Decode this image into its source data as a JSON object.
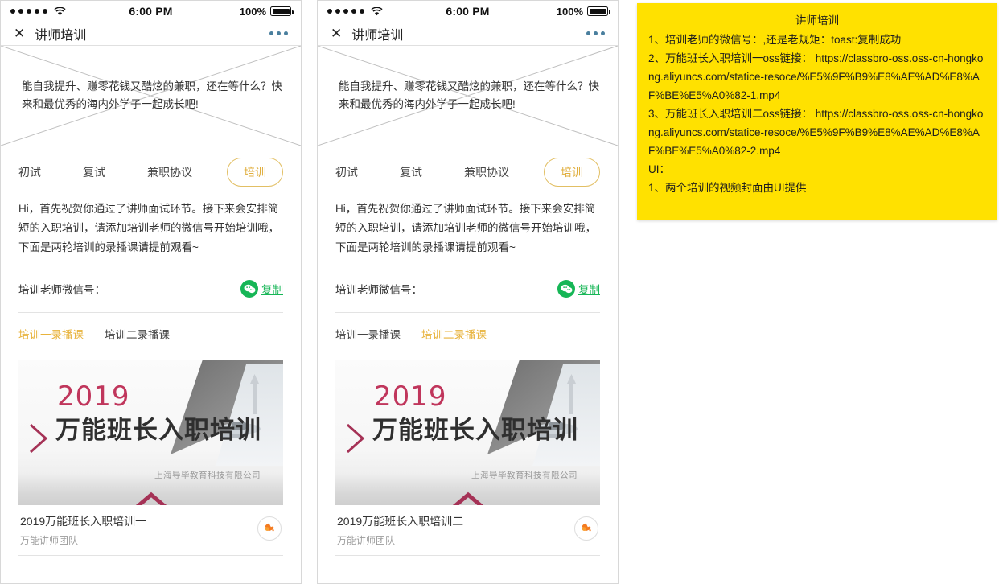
{
  "status_bar": {
    "signal_dots": 5,
    "wifi_icon": "wifi-icon",
    "time": "6:00 PM",
    "battery_pct": "100%",
    "battery_icon": "battery-full-icon"
  },
  "nav": {
    "close_label": "✕",
    "title": "讲师培训",
    "more_icon": "more-horizontal-icon"
  },
  "banner": {
    "placeholder_icon": "image-placeholder-cross",
    "text": "能自我提升、赚零花钱又酷炫的兼职，还在等什么？快来和最优秀的海内外学子一起成长吧!"
  },
  "steps": [
    {
      "label": "初试",
      "active": false
    },
    {
      "label": "复试",
      "active": false
    },
    {
      "label": "兼职协议",
      "active": false
    },
    {
      "label": "培训",
      "active": true
    }
  ],
  "intro": "Hi，首先祝贺你通过了讲师面试环节。接下来会安排简短的入职培训，请添加培训老师的微信号开始培训哦，下面是两轮培训的录播课请提前观看~",
  "wechat": {
    "label": "培训老师微信号：",
    "value": "",
    "icon": "wechat-icon",
    "copy_label": "复制"
  },
  "video_tabs": [
    {
      "label": "培训一录播课"
    },
    {
      "label": "培训二录播课"
    }
  ],
  "phones": [
    {
      "active_video_tab_index": 0,
      "video": {
        "thumb_year": "2019",
        "thumb_title": "万能班长入职培训",
        "thumb_watermark": "上海导毕教育科技有限公司",
        "title": "2019万能班长入职培训一",
        "subtitle": "万能讲师团队",
        "logo_icon": "brand-hand-logo-icon"
      }
    },
    {
      "active_video_tab_index": 1,
      "video": {
        "thumb_year": "2019",
        "thumb_title": "万能班长入职培训",
        "thumb_watermark": "上海导毕教育科技有限公司",
        "title": "2019万能班长入职培训二",
        "subtitle": "万能讲师团队",
        "logo_icon": "brand-hand-logo-icon"
      }
    }
  ],
  "note": {
    "title": "讲师培训",
    "lines": [
      "1、培训老师的微信号：,还是老规矩：toast:复制成功",
      "2、万能班长入职培训一oss链接： https://classbro-oss.oss-cn-hongkong.aliyuncs.com/statice-resoce/%E5%9F%B9%E8%AE%AD%E8%AF%BE%E5%A0%82-1.mp4",
      "3、万能班长入职培训二oss链接： https://classbro-oss.oss-cn-hongkong.aliyuncs.com/statice-resoce/%E5%9F%B9%E8%AE%AD%E8%AF%BE%E5%A0%82-2.mp4",
      "UI：",
      "1、两个培训的视频封面由UI提供"
    ]
  },
  "colors": {
    "accent_gold": "#e8b33c",
    "wechat_green": "#16b656",
    "note_yellow": "#ffe100",
    "thumb_pink": "#c0365c",
    "nav_dot_blue": "#4a7f9e"
  }
}
